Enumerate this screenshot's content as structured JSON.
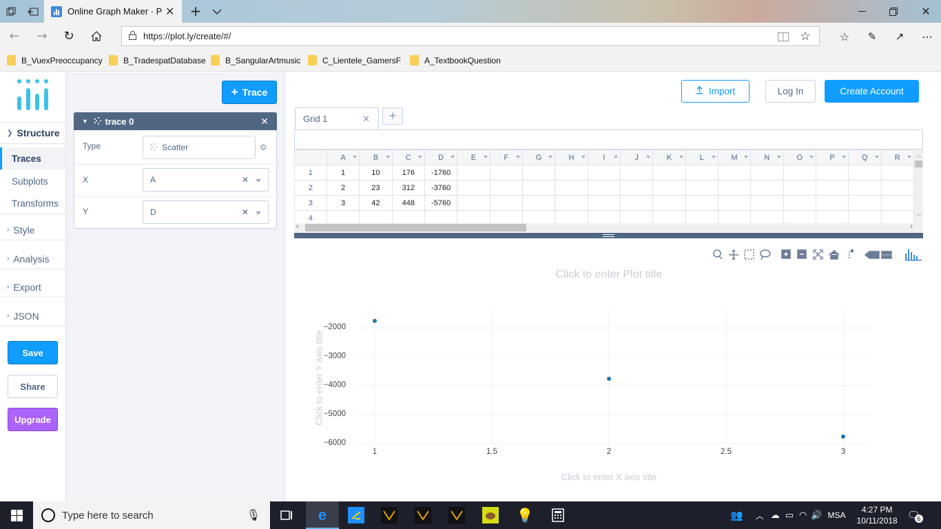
{
  "browser": {
    "tab_title": "Online Graph Maker · Pl",
    "url": "https://plot.ly/create/#/",
    "favorites": [
      "B_VuexPreoccupancy",
      "B_TradespatDatabase",
      "B_SangularArtmusic",
      "C_Lientele_GamersFre",
      "A_TextbookQuestion"
    ]
  },
  "sidebar": {
    "structure": "Structure",
    "sub": [
      "Traces",
      "Subplots",
      "Transforms"
    ],
    "sections": [
      "Style",
      "Analysis",
      "Export",
      "JSON"
    ],
    "save": "Save",
    "share": "Share",
    "upgrade": "Upgrade"
  },
  "panel": {
    "add_trace": "Trace",
    "trace_name": "trace 0",
    "type_label": "Type",
    "type_value": "Scatter",
    "x_label": "X",
    "x_value": "A",
    "y_label": "Y",
    "y_value": "D"
  },
  "header": {
    "import": "Import",
    "login": "Log In",
    "create_account": "Create Account"
  },
  "grid": {
    "tab": "Grid 1",
    "columns": [
      "A",
      "B",
      "C",
      "D",
      "E",
      "F",
      "G",
      "H",
      "I",
      "J",
      "K",
      "L",
      "M",
      "N",
      "O",
      "P",
      "Q",
      "R"
    ],
    "rows": [
      {
        "n": "1",
        "cells": [
          "1",
          "10",
          "176",
          "-1760"
        ]
      },
      {
        "n": "2",
        "cells": [
          "2",
          "23",
          "312",
          "-3760"
        ]
      },
      {
        "n": "3",
        "cells": [
          "3",
          "42",
          "448",
          "-5760"
        ]
      },
      {
        "n": "4",
        "cells": [
          "",
          "",
          "",
          ""
        ]
      }
    ]
  },
  "plot": {
    "title_placeholder": "Click to enter Plot title",
    "x_axis_placeholder": "Click to enter X axis title",
    "y_axis_placeholder": "Click to enter Y axis title"
  },
  "chart_data": {
    "type": "scatter",
    "x": [
      1,
      2,
      3
    ],
    "y": [
      -1760,
      -3760,
      -5760
    ],
    "x_ticks": [
      "1",
      "1.5",
      "2",
      "2.5",
      "3"
    ],
    "y_ticks": [
      "−2000",
      "−3000",
      "−4000",
      "−5000",
      "−6000"
    ],
    "xlim": [
      1,
      3
    ],
    "ylim": [
      -6000,
      -2000
    ],
    "grid": true,
    "marker_color": "#1f77b4"
  },
  "taskbar": {
    "search": "Type here to search",
    "lang": "MSA",
    "time": "4:27 PM",
    "date": "10/11/2018",
    "notifications": "6"
  }
}
